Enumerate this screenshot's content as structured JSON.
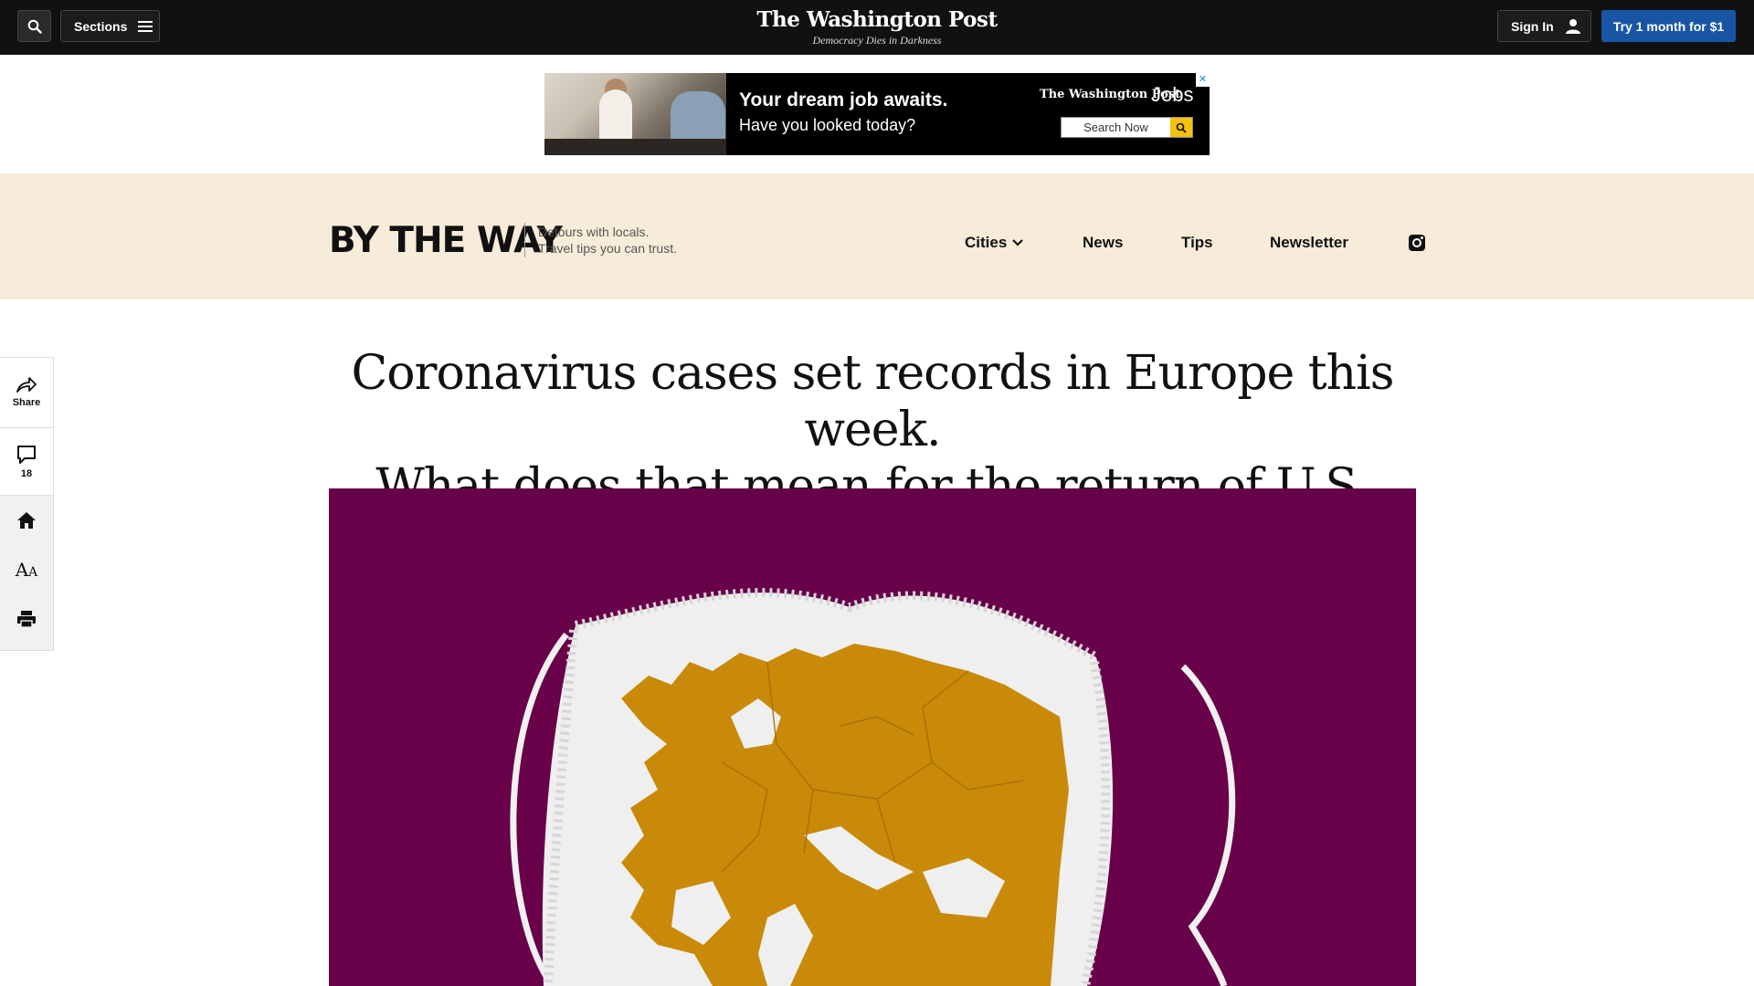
{
  "header": {
    "sections_label": "Sections",
    "masthead_title": "The Washington Post",
    "masthead_tagline": "Democracy Dies in Darkness",
    "signin_label": "Sign In",
    "subscribe_label": "Try 1 month for $1"
  },
  "ad": {
    "headline": "Your dream job awaits.",
    "subline": "Have you looked today?",
    "brand": "The Washington Post",
    "brand_product": "Jobs",
    "search_label": "Search Now"
  },
  "section_band": {
    "logo_text": "BY THE WAY",
    "tagline_line1": "Detours with locals.",
    "tagline_line2": "Travel tips you can trust.",
    "nav": [
      "Cities",
      "News",
      "Tips",
      "Newsletter"
    ],
    "accent_color": "#f6ecd9"
  },
  "rail": {
    "share_label": "Share",
    "comments_count": "18"
  },
  "article": {
    "headline_line1": "Coronavirus cases set records in Europe this week.",
    "headline_line2": "What does that mean for the return of U.S. travelers?",
    "hero_bg_color": "#68004a"
  }
}
